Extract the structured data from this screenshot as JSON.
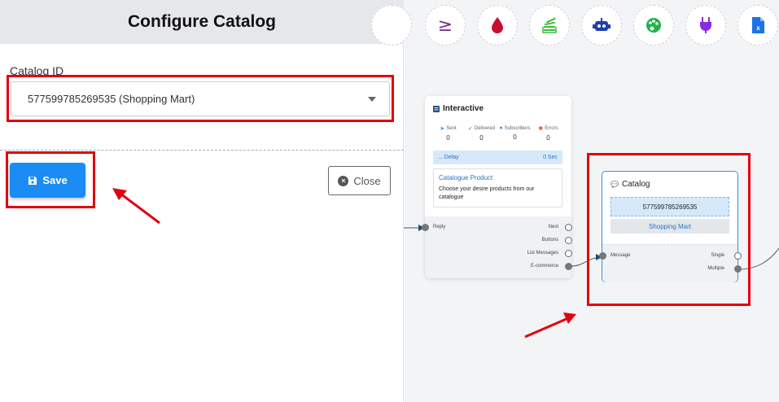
{
  "panel": {
    "title": "Configure Catalog",
    "catalog_label": "Catalog ID",
    "catalog_value": "577599785269535 (Shopping Mart)",
    "save_label": "Save",
    "close_label": "Close"
  },
  "toolbar": {
    "tools": [
      {
        "name": "greater-equal-icon",
        "glyph": "≥",
        "color": "#7b2f95"
      },
      {
        "name": "drop-icon",
        "glyph": "drop",
        "color": "#c8102e"
      },
      {
        "name": "stack-icon",
        "glyph": "stack",
        "color": "#3cbf3c"
      },
      {
        "name": "robot-icon",
        "glyph": "robot",
        "color": "#1f3fb0"
      },
      {
        "name": "palette-icon",
        "glyph": "palette",
        "color": "#20b24a"
      },
      {
        "name": "plug-icon",
        "glyph": "plug",
        "color": "#8a2be2"
      },
      {
        "name": "excel-file-icon",
        "glyph": "file",
        "color": "#1a73e8"
      }
    ]
  },
  "interactive_node": {
    "title": "Interactive",
    "stats": [
      {
        "label": "Sent",
        "value": "0",
        "icon": "send-icon",
        "color": "#3a8ee6"
      },
      {
        "label": "Delivered",
        "value": "0",
        "icon": "check-circle-icon",
        "color": "#2e9e3e"
      },
      {
        "label": "Subscribers",
        "value": "0",
        "icon": "user-circle-icon",
        "color": "#3a8ee6"
      },
      {
        "label": "Errors",
        "value": "0",
        "icon": "bug-icon",
        "color": "#e0472e"
      }
    ],
    "delay_label": "... Delay",
    "delay_value": "0 Sec",
    "product_title": "Catalogue Product",
    "product_desc": "Choose your desire products from our catalogue",
    "input_port": "Reply",
    "outputs": [
      "Next",
      "Buttons",
      "List Messages",
      "E-commerce"
    ]
  },
  "catalog_node": {
    "title": "Catalog",
    "catalog_id": "577599785269535",
    "catalog_name": "Shopping Mart",
    "input_port": "Message",
    "outputs": [
      "Single",
      "Multiple"
    ]
  },
  "colors": {
    "accent": "#1a8cf4",
    "highlight": "#e3000f",
    "node_border": "#3d8fe0"
  }
}
